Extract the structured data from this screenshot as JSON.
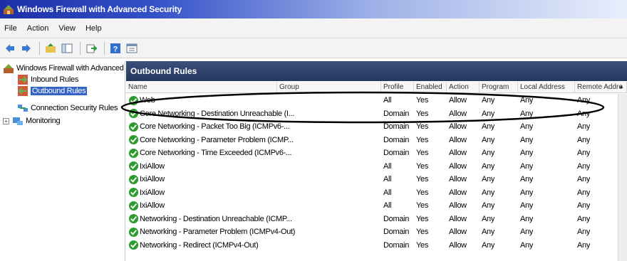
{
  "window": {
    "title": "Windows Firewall with Advanced Security"
  },
  "menu": [
    {
      "label": "File"
    },
    {
      "label": "Action"
    },
    {
      "label": "View"
    },
    {
      "label": "Help"
    }
  ],
  "toolbar": {
    "buttons": [
      "back-arrow-icon",
      "forward-arrow-icon",
      "up-folder-icon",
      "show-hide-tree-icon",
      "export-list-icon",
      "help-icon",
      "properties-icon"
    ]
  },
  "tree": {
    "root": "Windows Firewall with Advanced S",
    "items": [
      {
        "label": "Inbound Rules"
      },
      {
        "label": "Outbound Rules"
      },
      {
        "label": "Connection Security Rules"
      },
      {
        "label": "Monitoring",
        "expander": "+"
      }
    ]
  },
  "panel": {
    "title": "Outbound Rules",
    "columns": [
      "Name",
      "Group",
      "Profile",
      "Enabled",
      "Action",
      "Program",
      "Local Address",
      "Remote Addre"
    ],
    "rows": [
      {
        "name": "Web",
        "group": "",
        "profile": "All",
        "enabled": "Yes",
        "action": "Allow",
        "program": "Any",
        "local": "Any",
        "remote": "Any"
      },
      {
        "name": "Core Networking - Destination Unreachable (I...",
        "group": "",
        "profile": "Domain",
        "enabled": "Yes",
        "action": "Allow",
        "program": "Any",
        "local": "Any",
        "remote": "Any"
      },
      {
        "name": "Core Networking - Packet Too Big (ICMPv6-...",
        "group": "",
        "profile": "Domain",
        "enabled": "Yes",
        "action": "Allow",
        "program": "Any",
        "local": "Any",
        "remote": "Any"
      },
      {
        "name": "Core Networking - Parameter Problem (ICMP...",
        "group": "",
        "profile": "Domain",
        "enabled": "Yes",
        "action": "Allow",
        "program": "Any",
        "local": "Any",
        "remote": "Any"
      },
      {
        "name": "Core Networking - Time Exceeded (ICMPv6-...",
        "group": "",
        "profile": "Domain",
        "enabled": "Yes",
        "action": "Allow",
        "program": "Any",
        "local": "Any",
        "remote": "Any"
      },
      {
        "name": "IxiAllow",
        "group": "",
        "profile": "All",
        "enabled": "Yes",
        "action": "Allow",
        "program": "Any",
        "local": "Any",
        "remote": "Any"
      },
      {
        "name": "IxiAllow",
        "group": "",
        "profile": "All",
        "enabled": "Yes",
        "action": "Allow",
        "program": "Any",
        "local": "Any",
        "remote": "Any"
      },
      {
        "name": "IxiAllow",
        "group": "",
        "profile": "All",
        "enabled": "Yes",
        "action": "Allow",
        "program": "Any",
        "local": "Any",
        "remote": "Any"
      },
      {
        "name": "IxiAllow",
        "group": "",
        "profile": "All",
        "enabled": "Yes",
        "action": "Allow",
        "program": "Any",
        "local": "Any",
        "remote": "Any"
      },
      {
        "name": "Networking - Destination Unreachable (ICMP...",
        "group": "",
        "profile": "Domain",
        "enabled": "Yes",
        "action": "Allow",
        "program": "Any",
        "local": "Any",
        "remote": "Any"
      },
      {
        "name": "Networking - Parameter Problem (ICMPv4-Out)",
        "group": "",
        "profile": "Domain",
        "enabled": "Yes",
        "action": "Allow",
        "program": "Any",
        "local": "Any",
        "remote": "Any"
      },
      {
        "name": "Networking - Redirect (ICMPv4-Out)",
        "group": "",
        "profile": "Domain",
        "enabled": "Yes",
        "action": "Allow",
        "program": "Any",
        "local": "Any",
        "remote": "Any"
      }
    ]
  },
  "colors": {
    "title_gradient_start": "#1c2fa8",
    "panel_header": "#2e4470",
    "selection": "#3462c7",
    "rule_check": "#2e9b2e"
  }
}
